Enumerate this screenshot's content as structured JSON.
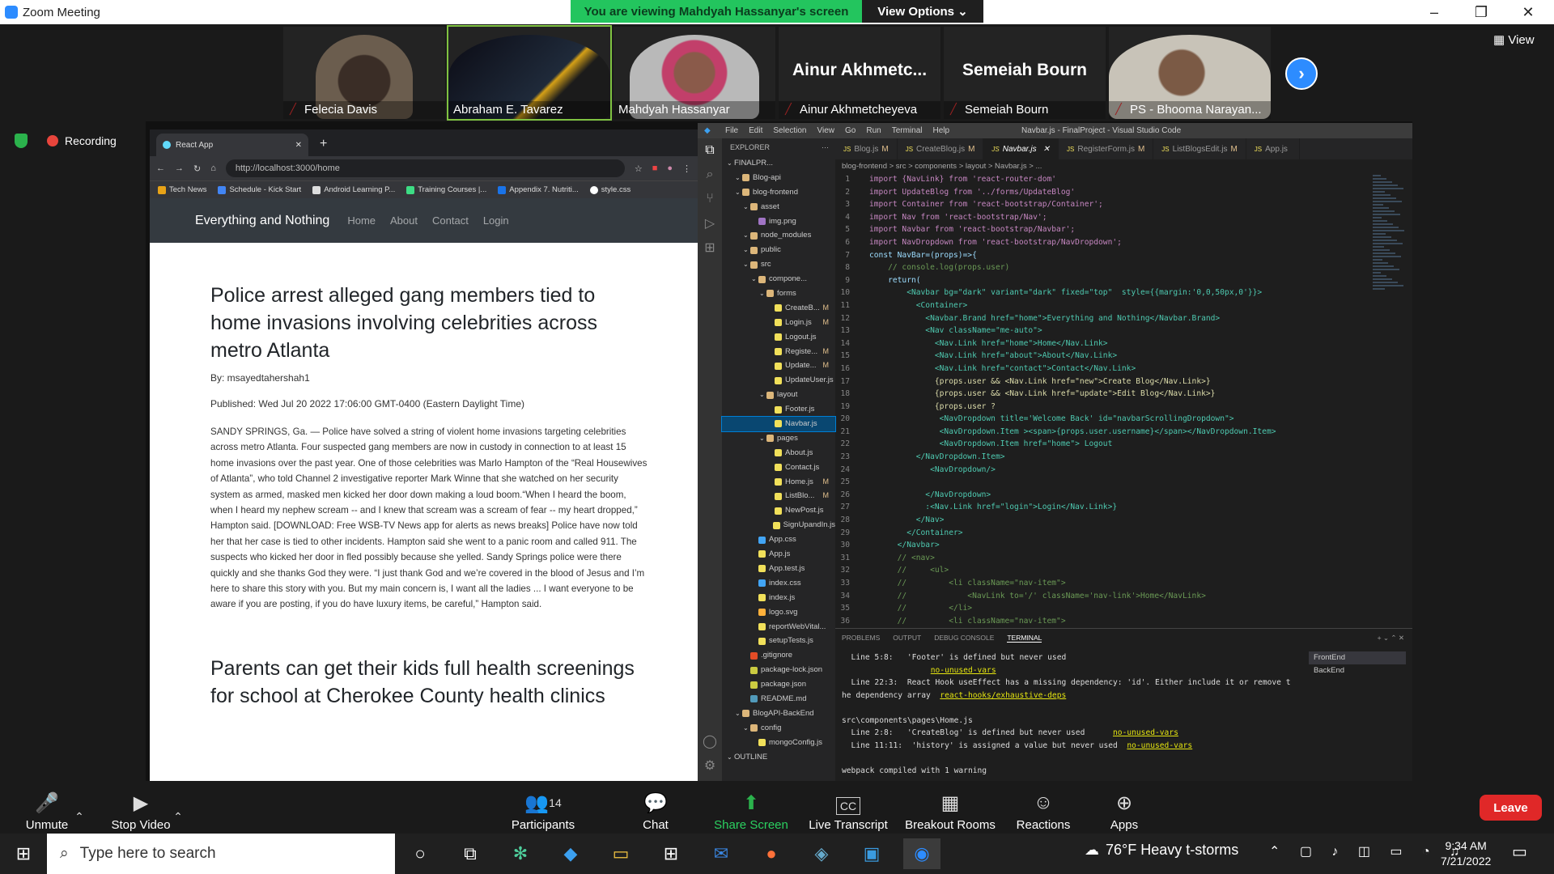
{
  "window": {
    "title": "Zoom Meeting"
  },
  "banner": {
    "text": "You are viewing Mahdyah Hassanyar's screen",
    "view_options": "View Options"
  },
  "participants": [
    {
      "name": "Felecia Davis",
      "video": true
    },
    {
      "name": "Abraham E. Tavarez",
      "video": true
    },
    {
      "name": "Mahdyah Hassanyar",
      "video": true
    },
    {
      "name": "Ainur Akhmetcheyeva",
      "video": false,
      "short": "Ainur  Akhmetc..."
    },
    {
      "name": "Semeiah Bourn",
      "video": false,
      "short": "Semeiah Bourn"
    },
    {
      "name": "PS - Bhooma Narayan...",
      "video": true
    }
  ],
  "view_button": "View",
  "recording": "Recording",
  "browser": {
    "tab_title": "React App",
    "url": "http://localhost:3000/home",
    "bookmarks": [
      "Tech News",
      "Schedule - Kick Start",
      "Android Learning P...",
      "Training Courses |...",
      "Appendix 7. Nutriti...",
      "style.css"
    ],
    "site": {
      "brand": "Everything and Nothing",
      "links": [
        "Home",
        "About",
        "Contact",
        "Login"
      ]
    },
    "articles": [
      {
        "title": "Police arrest alleged gang members tied to home invasions involving celebrities across metro Atlanta",
        "by": "By: msayedtahershah1",
        "published": "Published: Wed Jul 20 2022 17:06:00 GMT-0400 (Eastern Daylight Time)",
        "body": "SANDY SPRINGS, Ga. — Police have solved a string of violent home invasions targeting celebrities across metro Atlanta. Four suspected gang members are now in custody in connection to at least 15 home invasions over the past year. One of those celebrities was Marlo Hampton of the “Real Housewives of Atlanta”, who told Channel 2 investigative reporter Mark Winne that she watched on her security system as armed, masked men kicked her door down making a loud boom.“When I heard the boom, when I heard my nephew scream -- and I knew that scream was a scream of fear -- my heart dropped,” Hampton said. [DOWNLOAD: Free WSB-TV News app for alerts as news breaks] Police have now told her that her case is tied to other incidents. Hampton said she went to a panic room and called 911. The suspects who kicked her door in fled possibly because she yelled. Sandy Springs police were there quickly and she thanks God they were. “I just thank God and we’re covered in the blood of Jesus and I’m here to share this story with you. But my main concern is, I want all the ladies ... I want everyone to be aware if you are posting, if you do have luxury items, be careful,” Hampton said."
      },
      {
        "title": "Parents can get their kids full health screenings for school at Cherokee County health clinics"
      }
    ]
  },
  "vscode": {
    "menu": [
      "File",
      "Edit",
      "Selection",
      "View",
      "Go",
      "Run",
      "Terminal",
      "Help"
    ],
    "title": "Navbar.js - FinalProject - Visual Studio Code",
    "explorer_title": "EXPLORER",
    "tabs": [
      {
        "name": "Blog.js",
        "mark": "M",
        "active": false
      },
      {
        "name": "CreateBlog.js",
        "mark": "M",
        "active": false
      },
      {
        "name": "Navbar.js",
        "mark": "",
        "active": true
      },
      {
        "name": "RegisterForm.js",
        "mark": "M",
        "active": false
      },
      {
        "name": "ListBlogsEdit.js",
        "mark": "M",
        "active": false
      },
      {
        "name": "App.js",
        "mark": "",
        "active": false
      }
    ],
    "breadcrumb": "blog-frontend > src > components > layout > Navbar.js > ...",
    "tree": [
      {
        "label": "FINALPR...",
        "depth": 0,
        "kind": "root"
      },
      {
        "label": "Blog-api",
        "depth": 1,
        "kind": "folder"
      },
      {
        "label": "blog-frontend",
        "depth": 1,
        "kind": "folder"
      },
      {
        "label": "asset",
        "depth": 2,
        "kind": "folder"
      },
      {
        "label": "img.png",
        "depth": 3,
        "kind": "img"
      },
      {
        "label": "node_modules",
        "depth": 2,
        "kind": "folder"
      },
      {
        "label": "public",
        "depth": 2,
        "kind": "folder"
      },
      {
        "label": "src",
        "depth": 2,
        "kind": "folder"
      },
      {
        "label": "compone...",
        "depth": 3,
        "kind": "folder"
      },
      {
        "label": "forms",
        "depth": 4,
        "kind": "folder"
      },
      {
        "label": "CreateB...",
        "depth": 5,
        "kind": "js",
        "mark": "M"
      },
      {
        "label": "Login.js",
        "depth": 5,
        "kind": "js",
        "mark": "M"
      },
      {
        "label": "Logout.js",
        "depth": 5,
        "kind": "js"
      },
      {
        "label": "Registe...",
        "depth": 5,
        "kind": "js",
        "mark": "M"
      },
      {
        "label": "Update...",
        "depth": 5,
        "kind": "js",
        "mark": "M"
      },
      {
        "label": "UpdateUser.js",
        "depth": 5,
        "kind": "js"
      },
      {
        "label": "layout",
        "depth": 4,
        "kind": "folder"
      },
      {
        "label": "Footer.js",
        "depth": 5,
        "kind": "js"
      },
      {
        "label": "Navbar.js",
        "depth": 5,
        "kind": "js",
        "selected": true
      },
      {
        "label": "pages",
        "depth": 4,
        "kind": "folder"
      },
      {
        "label": "About.js",
        "depth": 5,
        "kind": "js"
      },
      {
        "label": "Contact.js",
        "depth": 5,
        "kind": "js"
      },
      {
        "label": "Home.js",
        "depth": 5,
        "kind": "js",
        "mark": "M"
      },
      {
        "label": "ListBlo...",
        "depth": 5,
        "kind": "js",
        "mark": "M"
      },
      {
        "label": "NewPost.js",
        "depth": 5,
        "kind": "js"
      },
      {
        "label": "SignUpandIn.js",
        "depth": 5,
        "kind": "js"
      },
      {
        "label": "App.css",
        "depth": 3,
        "kind": "css"
      },
      {
        "label": "App.js",
        "depth": 3,
        "kind": "js"
      },
      {
        "label": "App.test.js",
        "depth": 3,
        "kind": "test"
      },
      {
        "label": "index.css",
        "depth": 3,
        "kind": "css"
      },
      {
        "label": "index.js",
        "depth": 3,
        "kind": "js"
      },
      {
        "label": "logo.svg",
        "depth": 3,
        "kind": "svg"
      },
      {
        "label": "reportWebVital...",
        "depth": 3,
        "kind": "js"
      },
      {
        "label": "setupTests.js",
        "depth": 3,
        "kind": "js"
      },
      {
        "label": ".gitignore",
        "depth": 2,
        "kind": "git"
      },
      {
        "label": "package-lock.json",
        "depth": 2,
        "kind": "json"
      },
      {
        "label": "package.json",
        "depth": 2,
        "kind": "json"
      },
      {
        "label": "README.md",
        "depth": 2,
        "kind": "md"
      },
      {
        "label": "BlogAPI-BackEnd",
        "depth": 1,
        "kind": "folder"
      },
      {
        "label": "config",
        "depth": 2,
        "kind": "folder"
      },
      {
        "label": "mongoConfig.js",
        "depth": 3,
        "kind": "js"
      },
      {
        "label": "OUTLINE",
        "depth": 0,
        "kind": "section"
      }
    ],
    "code": [
      "import {NavLink} from 'react-router-dom'",
      "import UpdateBlog from '../forms/UpdateBlog'",
      "import Container from 'react-bootstrap/Container';",
      "import Nav from 'react-bootstrap/Nav';",
      "import Navbar from 'react-bootstrap/Navbar';",
      "import NavDropdown from 'react-bootstrap/NavDropdown';",
      "const NavBar=(props)=>{",
      "    // console.log(props.user)",
      "    return(",
      "        <Navbar bg=\"dark\" variant=\"dark\" fixed=\"top\"  style={{margin:'0,0,50px,0'}}>",
      "          <Container>",
      "            <Navbar.Brand href=\"home\">Everything and Nothing</Navbar.Brand>",
      "            <Nav className=\"me-auto\">",
      "              <Nav.Link href=\"home\">Home</Nav.Link>",
      "              <Nav.Link href=\"about\">About</Nav.Link>",
      "              <Nav.Link href=\"contact\">Contact</Nav.Link>",
      "              {props.user && <Nav.Link href=\"new\">Create Blog</Nav.Link>}",
      "              {props.user && <Nav.Link href=\"update\">Edit Blog</Nav.Link>}",
      "              {props.user ?",
      "               <NavDropdown title='Welcome Back' id=\"navbarScrollingDropdown\">",
      "               <NavDropdown.Item ><span>{props.user.username}</span></NavDropdown.Item>",
      "               <NavDropdown.Item href=\"home\"> Logout",
      "          </NavDropdown.Item>",
      "             <NavDropdown/>",
      "",
      "            </NavDropdown>",
      "            :<Nav.Link href=\"login\">Login</Nav.Link>}",
      "          </Nav>",
      "        </Container>",
      "      </Navbar>",
      "      // <nav>",
      "      //     <ul>",
      "      //         <li className=\"nav-item\">",
      "      //             <NavLink to='/' className='nav-link'>Home</NavLink>",
      "      //         </li>",
      "      //         <li className=\"nav-item\">"
    ],
    "panel_tabs": [
      "PROBLEMS",
      "OUTPUT",
      "DEBUG CONSOLE",
      "TERMINAL"
    ],
    "terminal": [
      {
        "text": "  Line 5:8:   'Footer' is defined but never used",
        "warn": ""
      },
      {
        "text": "                   ",
        "warn": "no-unused-vars"
      },
      {
        "text": "  Line 22:3:  React Hook useEffect has a missing dependency: 'id'. Either include it or remove t",
        "warn": ""
      },
      {
        "text": "he dependency array  ",
        "warn": "react-hooks/exhaustive-deps"
      },
      {
        "text": "",
        "warn": ""
      },
      {
        "text": "src\\components\\pages\\Home.js",
        "warn": ""
      },
      {
        "text": "  Line 2:8:   'CreateBlog' is defined but never used      ",
        "warn": "no-unused-vars"
      },
      {
        "text": "  Line 11:11:  'history' is assigned a value but never used  ",
        "warn": "no-unused-vars"
      },
      {
        "text": "",
        "warn": ""
      },
      {
        "text": "webpack compiled with 1 warning",
        "warn": ""
      }
    ],
    "terminal_list": [
      "FrontEnd",
      "BackEnd"
    ]
  },
  "toolbar": {
    "unmute": "Unmute",
    "stop_video": "Stop Video",
    "participants": "Participants",
    "participants_count": "14",
    "chat": "Chat",
    "share_screen": "Share Screen",
    "live_transcript": "Live Transcript",
    "breakout_rooms": "Breakout Rooms",
    "reactions": "Reactions",
    "apps": "Apps",
    "leave": "Leave"
  },
  "taskbar": {
    "search_placeholder": "Type here to search",
    "weather": "76°F  Heavy t-storms",
    "time": "9:34 AM",
    "date": "7/21/2022"
  }
}
